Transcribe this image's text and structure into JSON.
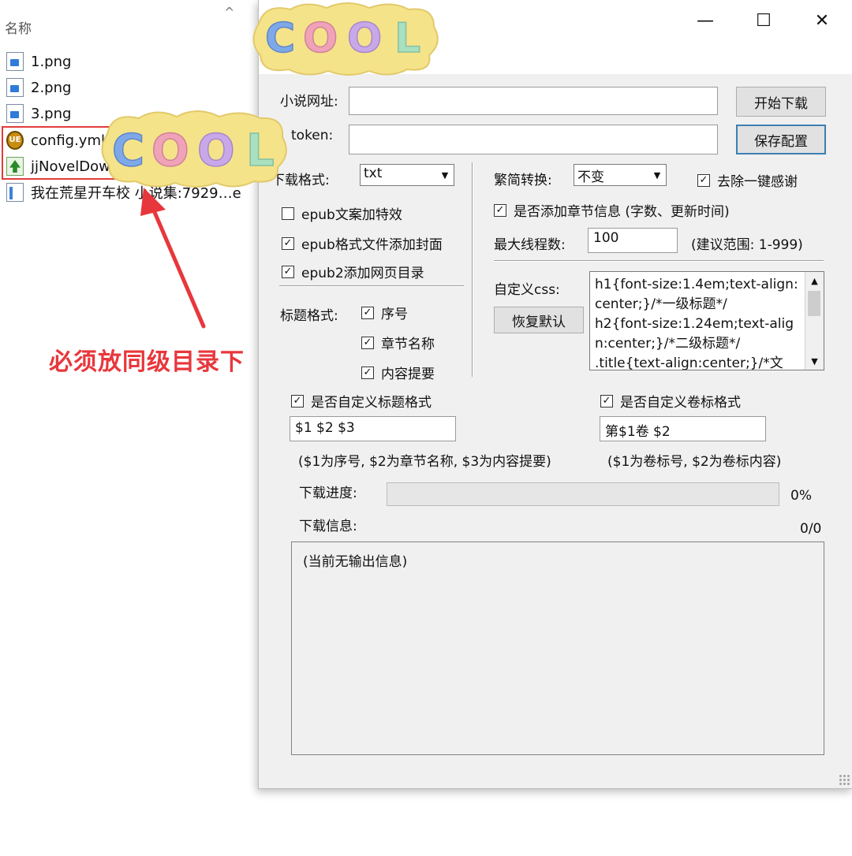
{
  "explorer": {
    "column_header": "名称",
    "sort_indicator": "^",
    "files": [
      {
        "name": "1.png",
        "icon": "png-file-icon"
      },
      {
        "name": "2.png",
        "icon": "png-file-icon"
      },
      {
        "name": "3.png",
        "icon": "png-file-icon"
      },
      {
        "name": "config.yml",
        "icon": "ultraedit-file-icon"
      },
      {
        "name": "jjNovelDow",
        "icon": "application-icon"
      },
      {
        "name": "我在荒星开车校 小说集:7929…e",
        "icon": "text-file-icon"
      }
    ],
    "annotation": "必须放同级目录下",
    "annotation_color": "#e8373c"
  },
  "window": {
    "controls": {
      "minimize": "—",
      "maximize": "☐",
      "close": "✕"
    },
    "novel_url_label": "小说网址:",
    "novel_url_value": "",
    "token_label": "token:",
    "token_value": "",
    "start_download": "开始下载",
    "save_config": "保存配置",
    "format_label": "下载格式:",
    "format_value": "txt",
    "conversion_label": "繁简转换:",
    "conversion_value": "不变",
    "remove_thanks": "去除一键感谢",
    "remove_thanks_checked": true,
    "epub_effects": "epub文案加特效",
    "epub_effects_checked": false,
    "epub_cover": "epub格式文件添加封面",
    "epub_cover_checked": true,
    "epub2_toc": "epub2添加网页目录",
    "epub2_toc_checked": true,
    "chapter_info": "是否添加章节信息 (字数、更新时间)",
    "chapter_info_checked": true,
    "max_threads_label": "最大线程数:",
    "max_threads_value": "100",
    "threads_hint": "(建议范围: 1-999)",
    "custom_css_label": "自定义css:",
    "restore_default": "恢复默认",
    "custom_css_value": "h1{font-size:1.4em;text-align:center;}/*一级标题*/\nh2{font-size:1.24em;text-align:center;}/*二级标题*/\n.title{text-align:center;}/*文",
    "title_format_label": "标题格式:",
    "title_options": [
      {
        "label": "序号",
        "checked": true
      },
      {
        "label": "章节名称",
        "checked": true
      },
      {
        "label": "内容提要",
        "checked": true
      }
    ],
    "custom_title_format": "是否自定义标题格式",
    "custom_title_format_checked": true,
    "title_format_value": "$1 $2 $3",
    "title_format_hint": "($1为序号, $2为章节名称, $3为内容提要)",
    "custom_volume_format": "是否自定义卷标格式",
    "custom_volume_format_checked": true,
    "volume_format_value": "第$1卷 $2",
    "volume_format_hint": "($1为卷标号, $2为卷标内容)",
    "progress_label": "下载进度:",
    "progress_value": 0,
    "progress_text": "0%",
    "info_label": "下载信息:",
    "info_count": "0/0",
    "output_text": "(当前无输出信息)"
  },
  "stickers": {
    "text": "COOL",
    "letter_colors": [
      "#7fa8e8",
      "#f0a3b8",
      "#c8a8e8",
      "#a8e0c0"
    ],
    "bg_color": "#f5e38a"
  }
}
